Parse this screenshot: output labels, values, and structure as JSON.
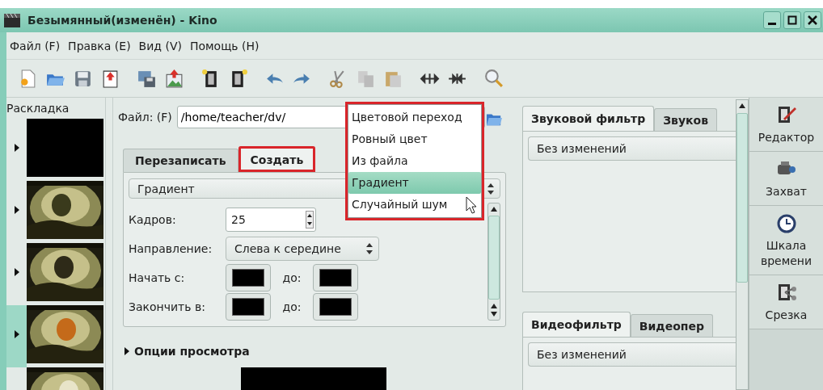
{
  "window": {
    "title": "Безымянный(изменён) - Kino"
  },
  "menu": [
    {
      "label": "Файл (F)"
    },
    {
      "label": "Правка (E)"
    },
    {
      "label": "Вид (V)"
    },
    {
      "label": "Помощь (H)"
    }
  ],
  "storyboard": {
    "title": "Раскладка",
    "frames": [
      {
        "kind": "black",
        "selected": false
      },
      {
        "kind": "picture",
        "selected": false
      },
      {
        "kind": "picture",
        "selected": false
      },
      {
        "kind": "picture",
        "selected": true
      },
      {
        "kind": "picture",
        "selected": false
      }
    ]
  },
  "export": {
    "file_label": "Файл: (F)",
    "file_value": "/home/teacher/dv/",
    "tabs": [
      {
        "label": "Перезаписать",
        "selected": false,
        "highlighted": false
      },
      {
        "label": "Создать",
        "selected": true,
        "highlighted": true
      }
    ],
    "generator": "Градиент",
    "fields": [
      {
        "kind": "spin",
        "label": "Кадров:",
        "value": "25"
      },
      {
        "kind": "combo",
        "label": "Направление:",
        "value": "Слева к середине"
      },
      {
        "kind": "colors",
        "label": "Начать с:",
        "to_label": "до:"
      },
      {
        "kind": "colors",
        "label": "Закончить в:",
        "to_label": "до:"
      }
    ],
    "preview_options": "Опции просмотра",
    "popup": {
      "highlighted": true,
      "items": [
        {
          "label": "Цветовой переход",
          "selected": false
        },
        {
          "label": "Ровный цвет",
          "selected": false
        },
        {
          "label": "Из файла",
          "selected": false
        },
        {
          "label": "Градиент",
          "selected": true
        },
        {
          "label": "Случайный шум",
          "selected": false
        }
      ]
    }
  },
  "audio": {
    "tabs": [
      {
        "label": "Звуковой фильтр",
        "selected": true
      },
      {
        "label": "Звуков",
        "selected": false
      }
    ],
    "value": "Без изменений"
  },
  "video": {
    "tabs": [
      {
        "label": "Видеофильтр",
        "selected": true
      },
      {
        "label": "Видеопер",
        "selected": false
      }
    ],
    "value": "Без изменений"
  },
  "modes": [
    {
      "label": "Редактор",
      "selected": false
    },
    {
      "label": "Захват",
      "selected": false
    },
    {
      "label": "Шкала времени",
      "selected": false
    },
    {
      "label": "Срезка",
      "selected": false
    }
  ]
}
